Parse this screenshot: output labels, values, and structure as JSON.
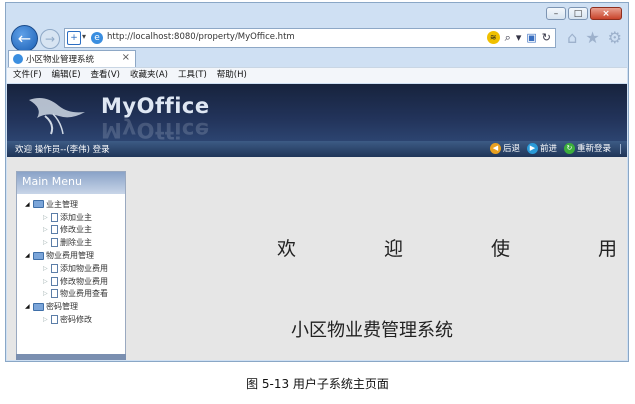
{
  "browser": {
    "address_url": "http://localhost:8080/property/MyOffice.htm",
    "tab_title": "小区物业管理系统",
    "tab_close": "×",
    "caption_buttons": [
      "–",
      "□",
      "×"
    ]
  },
  "menu": [
    "文件(F)",
    "编辑(E)",
    "查看(V)",
    "收藏夹(A)",
    "工具(T)",
    "帮助(H)"
  ],
  "app": {
    "brand": "MyOffice",
    "welcome_text": "欢迎 操作员--(李伟) 登录",
    "links": {
      "back": "后退",
      "forward": "前进",
      "relogin": "重新登录"
    },
    "sidebar_title": "Main Menu",
    "tree": [
      {
        "label": "业主管理",
        "children": [
          "添加业主",
          "修改业主",
          "删除业主"
        ]
      },
      {
        "label": "物业费用管理",
        "children": [
          "添加物业费用",
          "修改物业费用",
          "物业费用查看"
        ]
      },
      {
        "label": "密码管理",
        "children": [
          "密码修改"
        ]
      }
    ],
    "welcome_chars": [
      "欢",
      "迎",
      "使",
      "用"
    ],
    "system_name": "小区物业费管理系统"
  },
  "figure_caption": "图 5-13 用户子系统主页面"
}
